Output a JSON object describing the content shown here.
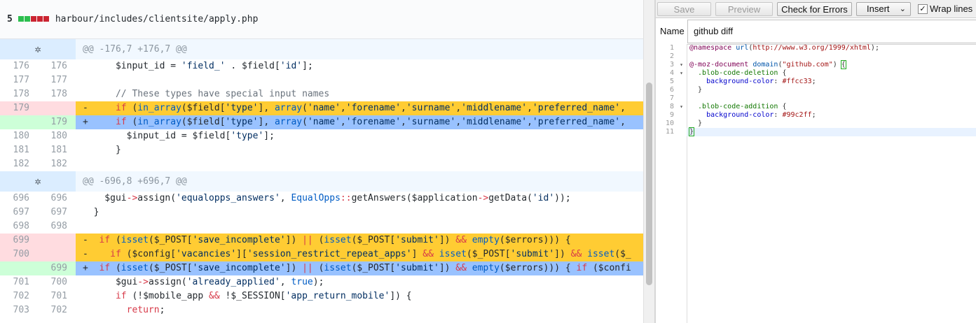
{
  "file_header": {
    "count": "5",
    "diffstat_colors": [
      "#2cbe4e",
      "#2cbe4e",
      "#cb2431",
      "#cb2431",
      "#cb2431"
    ],
    "path": "harbour/includes/clientsite/apply.php"
  },
  "diff_rows": [
    {
      "type": "hunk",
      "text": "@@ -176,7 +176,7 @@",
      "icon": "expand-icon"
    },
    {
      "type": "ctx",
      "old": "176",
      "new": "176",
      "tokens": [
        [
          "      ",
          "v"
        ],
        [
          "$input_id",
          "v"
        ],
        [
          " = ",
          "v"
        ],
        [
          "'field_'",
          "s"
        ],
        [
          " . $field[",
          "v"
        ],
        [
          "'id'",
          "s"
        ],
        [
          "];",
          "v"
        ]
      ]
    },
    {
      "type": "ctx",
      "old": "177",
      "new": "177",
      "tokens": []
    },
    {
      "type": "ctx",
      "old": "178",
      "new": "178",
      "tokens": [
        [
          "      // These types have special input names",
          "c"
        ]
      ]
    },
    {
      "type": "del",
      "old": "179",
      "new": "",
      "tokens": [
        [
          "-     ",
          "v"
        ],
        [
          "if",
          "k"
        ],
        [
          " (",
          "v"
        ],
        [
          "in_array",
          "f"
        ],
        [
          "($field[",
          "v"
        ],
        [
          "'type'",
          "s"
        ],
        [
          "], ",
          "v"
        ],
        [
          "array",
          "f"
        ],
        [
          "(",
          "v"
        ],
        [
          "'name'",
          "s"
        ],
        [
          ",",
          "v"
        ],
        [
          "'forename'",
          "s"
        ],
        [
          ",",
          "v"
        ],
        [
          "'surname'",
          "s"
        ],
        [
          ",",
          "v"
        ],
        [
          "'middlename'",
          "s"
        ],
        [
          ",",
          "v"
        ],
        [
          "'preferred_name'",
          "s"
        ],
        [
          ",",
          "v"
        ]
      ]
    },
    {
      "type": "add",
      "old": "",
      "new": "179",
      "tokens": [
        [
          "+     ",
          "v"
        ],
        [
          "if",
          "k"
        ],
        [
          " (",
          "v"
        ],
        [
          "in_array",
          "f"
        ],
        [
          "($field[",
          "v"
        ],
        [
          "'type'",
          "s"
        ],
        [
          "], ",
          "v"
        ],
        [
          "array",
          "f"
        ],
        [
          "(",
          "v"
        ],
        [
          "'name'",
          "s"
        ],
        [
          ",",
          "v"
        ],
        [
          "'forename'",
          "s"
        ],
        [
          ",",
          "v"
        ],
        [
          "'surname'",
          "s"
        ],
        [
          ",",
          "v"
        ],
        [
          "'middlename'",
          "s"
        ],
        [
          ",",
          "v"
        ],
        [
          "'preferred_name'",
          "s"
        ],
        [
          ",",
          "v"
        ]
      ]
    },
    {
      "type": "ctx",
      "old": "180",
      "new": "180",
      "tokens": [
        [
          "        $input_id = $field[",
          "v"
        ],
        [
          "'type'",
          "s"
        ],
        [
          "];",
          "v"
        ]
      ]
    },
    {
      "type": "ctx",
      "old": "181",
      "new": "181",
      "tokens": [
        [
          "      }",
          "v"
        ]
      ]
    },
    {
      "type": "ctx",
      "old": "182",
      "new": "182",
      "tokens": []
    },
    {
      "type": "hunk",
      "text": "@@ -696,8 +696,7 @@",
      "icon": "expand-icon"
    },
    {
      "type": "ctx",
      "old": "696",
      "new": "696",
      "tokens": [
        [
          "    $gui",
          "v"
        ],
        [
          "->",
          "k"
        ],
        [
          "assign(",
          "v"
        ],
        [
          "'equalopps_answers'",
          "s"
        ],
        [
          ", ",
          "v"
        ],
        [
          "EqualOpps",
          "f"
        ],
        [
          "::",
          "k"
        ],
        [
          "getAnswers($application",
          "v"
        ],
        [
          "->",
          "k"
        ],
        [
          "getData(",
          "v"
        ],
        [
          "'id'",
          "s"
        ],
        [
          "));",
          "v"
        ]
      ]
    },
    {
      "type": "ctx",
      "old": "697",
      "new": "697",
      "tokens": [
        [
          "  }",
          "v"
        ]
      ]
    },
    {
      "type": "ctx",
      "old": "698",
      "new": "698",
      "tokens": []
    },
    {
      "type": "del",
      "old": "699",
      "new": "",
      "tokens": [
        [
          "-  ",
          "v"
        ],
        [
          "if",
          "k"
        ],
        [
          " (",
          "v"
        ],
        [
          "isset",
          "f"
        ],
        [
          "($_POST[",
          "v"
        ],
        [
          "'save_incomplete'",
          "s"
        ],
        [
          "]) ",
          "v"
        ],
        [
          "||",
          "k"
        ],
        [
          " (",
          "v"
        ],
        [
          "isset",
          "f"
        ],
        [
          "($_POST[",
          "v"
        ],
        [
          "'submit'",
          "s"
        ],
        [
          "]) ",
          "v"
        ],
        [
          "&&",
          "k"
        ],
        [
          " ",
          "v"
        ],
        [
          "empty",
          "f"
        ],
        [
          "($errors))) {",
          "v"
        ]
      ]
    },
    {
      "type": "del",
      "old": "700",
      "new": "",
      "tokens": [
        [
          "-    ",
          "v"
        ],
        [
          "if",
          "k"
        ],
        [
          " ($config[",
          "v"
        ],
        [
          "'vacancies'",
          "s"
        ],
        [
          "][",
          "v"
        ],
        [
          "'session_restrict_repeat_apps'",
          "s"
        ],
        [
          "] ",
          "v"
        ],
        [
          "&&",
          "k"
        ],
        [
          " ",
          "v"
        ],
        [
          "isset",
          "f"
        ],
        [
          "($_POST[",
          "v"
        ],
        [
          "'submit'",
          "s"
        ],
        [
          "]) ",
          "v"
        ],
        [
          "&&",
          "k"
        ],
        [
          " ",
          "v"
        ],
        [
          "isset",
          "f"
        ],
        [
          "($_",
          "v"
        ]
      ]
    },
    {
      "type": "add",
      "old": "",
      "new": "699",
      "tokens": [
        [
          "+  ",
          "v"
        ],
        [
          "if",
          "k"
        ],
        [
          " (",
          "v"
        ],
        [
          "isset",
          "f"
        ],
        [
          "($_POST[",
          "v"
        ],
        [
          "'save_incomplete'",
          "s"
        ],
        [
          "]) ",
          "v"
        ],
        [
          "||",
          "k"
        ],
        [
          " (",
          "v"
        ],
        [
          "isset",
          "f"
        ],
        [
          "($_POST[",
          "v"
        ],
        [
          "'submit'",
          "s"
        ],
        [
          "]) ",
          "v"
        ],
        [
          "&&",
          "k"
        ],
        [
          " ",
          "v"
        ],
        [
          "empty",
          "f"
        ],
        [
          "($errors))) { ",
          "v"
        ],
        [
          "if",
          "k"
        ],
        [
          " ($confi",
          "v"
        ]
      ]
    },
    {
      "type": "ctx",
      "old": "701",
      "new": "700",
      "tokens": [
        [
          "      $gui",
          "v"
        ],
        [
          "->",
          "k"
        ],
        [
          "assign(",
          "v"
        ],
        [
          "'already_applied'",
          "s"
        ],
        [
          ", ",
          "v"
        ],
        [
          "true",
          "f"
        ],
        [
          ");",
          "v"
        ]
      ]
    },
    {
      "type": "ctx",
      "old": "702",
      "new": "701",
      "tokens": [
        [
          "      ",
          "v"
        ],
        [
          "if",
          "k"
        ],
        [
          " (!$mobile_app ",
          "v"
        ],
        [
          "&&",
          "k"
        ],
        [
          " !$_SESSION[",
          "v"
        ],
        [
          "'app_return_mobile'",
          "s"
        ],
        [
          "]) {",
          "v"
        ]
      ]
    },
    {
      "type": "ctx",
      "old": "703",
      "new": "702",
      "tokens": [
        [
          "        ",
          "v"
        ],
        [
          "return",
          "k"
        ],
        [
          ";",
          "v"
        ]
      ]
    }
  ],
  "toolbar": {
    "save_label": "Save",
    "preview_label": "Preview",
    "check_label": "Check for Errors",
    "insert_label": "Insert",
    "insert_arrow": "⌄",
    "wrap_label": "Wrap lines",
    "wrap_checked": "✓"
  },
  "name_field": {
    "label": "Name",
    "value": "github diff"
  },
  "editor": {
    "gutter": [
      {
        "n": "1",
        "fold": ""
      },
      {
        "n": "2",
        "fold": ""
      },
      {
        "n": "3",
        "fold": "▾"
      },
      {
        "n": "4",
        "fold": "▾"
      },
      {
        "n": "5",
        "fold": ""
      },
      {
        "n": "6",
        "fold": ""
      },
      {
        "n": "7",
        "fold": ""
      },
      {
        "n": "8",
        "fold": "▾"
      },
      {
        "n": "9",
        "fold": ""
      },
      {
        "n": "10",
        "fold": ""
      },
      {
        "n": "11",
        "fold": ""
      }
    ],
    "lines": [
      [
        [
          "@namespace",
          "at"
        ],
        [
          " ",
          "t"
        ],
        [
          "url",
          "fn"
        ],
        [
          "(",
          "t"
        ],
        [
          "http://www.w3.org/1999/xhtml",
          "str"
        ],
        [
          ");",
          "t"
        ]
      ],
      [],
      [
        [
          "@-moz-document",
          "at"
        ],
        [
          " ",
          "t"
        ],
        [
          "domain",
          "fn"
        ],
        [
          "(",
          "t"
        ],
        [
          "\"github.com\"",
          "str"
        ],
        [
          ") ",
          "t"
        ],
        [
          "{",
          "br"
        ]
      ],
      [
        [
          "  .blob-code-deletion",
          "sel"
        ],
        [
          " {",
          "t"
        ]
      ],
      [
        [
          "    background-color",
          "prop"
        ],
        [
          ": ",
          "t"
        ],
        [
          "#ffcc33",
          "hex"
        ],
        [
          ";",
          "t"
        ]
      ],
      [
        [
          "  }",
          "t"
        ]
      ],
      [],
      [
        [
          "  .blob-code-addition",
          "sel"
        ],
        [
          " {",
          "t"
        ]
      ],
      [
        [
          "    background-color",
          "prop"
        ],
        [
          ": ",
          "t"
        ],
        [
          "#99c2ff",
          "hex"
        ],
        [
          ";",
          "t"
        ]
      ],
      [
        [
          "  }",
          "t"
        ]
      ],
      [
        [
          "}",
          "br"
        ]
      ]
    ]
  }
}
